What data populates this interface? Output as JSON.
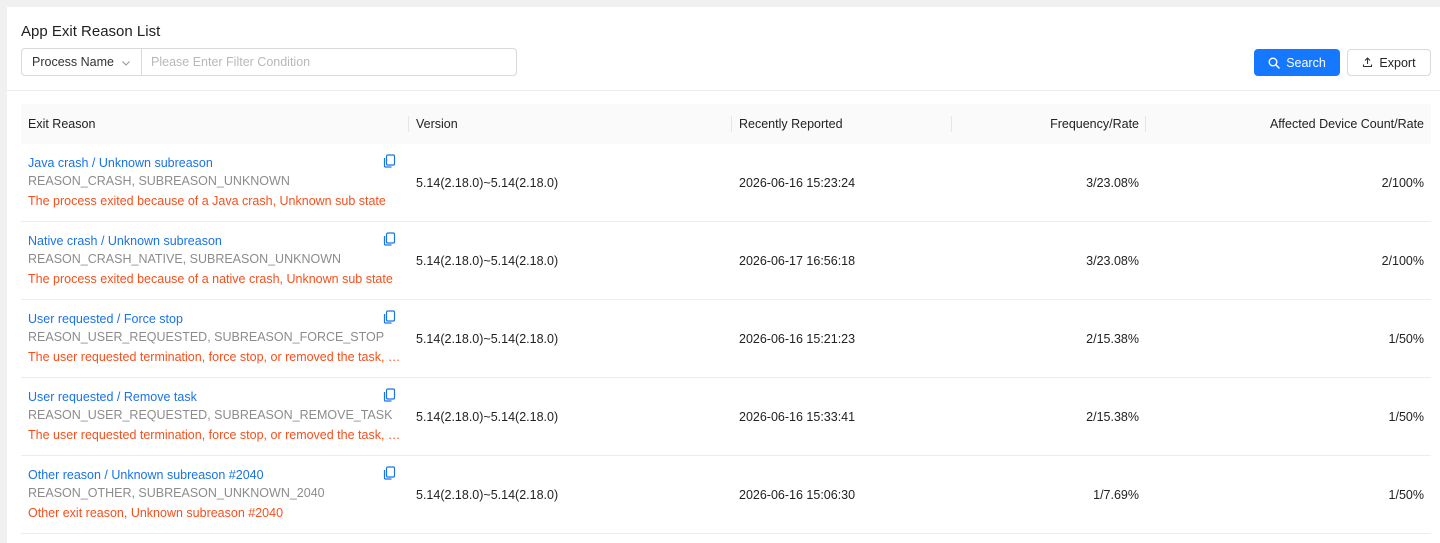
{
  "page": {
    "title": "App Exit Reason List"
  },
  "filter": {
    "field_label": "Process Name",
    "placeholder": "Please Enter Filter Condition"
  },
  "actions": {
    "search_label": "Search",
    "export_label": "Export"
  },
  "colors": {
    "accent": "#1677ff",
    "link": "#1a73e8",
    "description": "#f5501e"
  },
  "table": {
    "columns": [
      "Exit Reason",
      "Version",
      "Recently Reported",
      "Frequency/Rate",
      "Affected Device Count/Rate"
    ],
    "rows": [
      {
        "title": "Java crash / Unknown subreason",
        "code": "REASON_CRASH, SUBREASON_UNKNOWN",
        "desc": "The process exited because of a Java crash, Unknown sub state",
        "version": "5.14(2.18.0)~5.14(2.18.0)",
        "reported": "2026-06-16 15:23:24",
        "frequency": "3/23.08%",
        "devices": "2/100%"
      },
      {
        "title": "Native crash / Unknown subreason",
        "code": "REASON_CRASH_NATIVE, SUBREASON_UNKNOWN",
        "desc": "The process exited because of a native crash, Unknown sub state",
        "version": "5.14(2.18.0)~5.14(2.18.0)",
        "reported": "2026-06-17 16:56:18",
        "frequency": "3/23.08%",
        "devices": "2/100%"
      },
      {
        "title": "User requested / Force stop",
        "code": "REASON_USER_REQUESTED, SUBREASON_FORCE_STOP",
        "desc": "The user requested termination, force stop, or removed the task, Force stop",
        "version": "5.14(2.18.0)~5.14(2.18.0)",
        "reported": "2026-06-16 15:21:23",
        "frequency": "2/15.38%",
        "devices": "1/50%"
      },
      {
        "title": "User requested / Remove task",
        "code": "REASON_USER_REQUESTED, SUBREASON_REMOVE_TASK",
        "desc": "The user requested termination, force stop, or removed the task, Remove task",
        "version": "5.14(2.18.0)~5.14(2.18.0)",
        "reported": "2026-06-16 15:33:41",
        "frequency": "2/15.38%",
        "devices": "1/50%"
      },
      {
        "title": "Other reason / Unknown subreason #2040",
        "code": "REASON_OTHER, SUBREASON_UNKNOWN_2040",
        "desc": "Other exit reason, Unknown subreason #2040",
        "version": "5.14(2.18.0)~5.14(2.18.0)",
        "reported": "2026-06-16 15:06:30",
        "frequency": "1/7.69%",
        "devices": "1/50%"
      }
    ]
  }
}
